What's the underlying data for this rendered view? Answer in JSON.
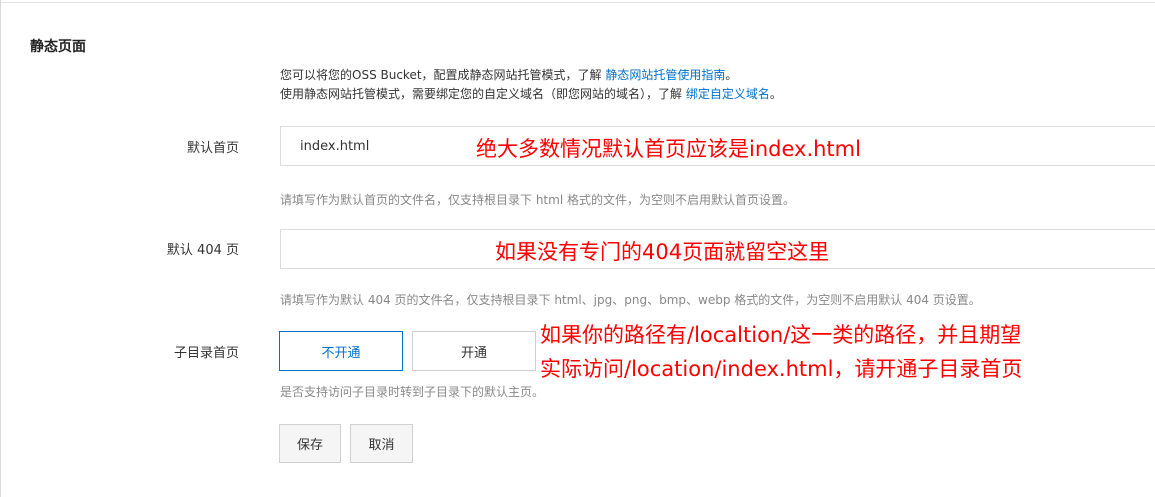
{
  "section": {
    "title": "静态页面"
  },
  "intro": {
    "line1_text": "您可以将您的OSS Bucket，配置成静态网站托管模式，了解 ",
    "line1_link": "静态网站托管使用指南",
    "line1_end": "。",
    "line2_text": "使用静态网站托管模式，需要绑定您的自定义域名（即您网站的域名），了解 ",
    "line2_link": "绑定自定义域名",
    "line2_end": "。"
  },
  "default_index": {
    "label": "默认首页",
    "value": "index.html",
    "help": "请填写作为默认首页的文件名，仅支持根目录下 html 格式的文件，为空则不启用默认首页设置。"
  },
  "default_404": {
    "label": "默认 404 页",
    "value": "",
    "help": "请填写作为默认 404 页的文件名，仅支持根目录下 html、jpg、png、bmp、webp 格式的文件，为空则不启用默认 404 页设置。"
  },
  "subdir_index": {
    "label": "子目录首页",
    "options": [
      "不开通",
      "开通"
    ],
    "selected": "不开通",
    "help": "是否支持访问子目录时转到子目录下的默认主页。"
  },
  "actions": {
    "save": "保存",
    "cancel": "取消"
  },
  "annotations": {
    "index_note": "绝大多数情况默认首页应该是index.html",
    "note_404": "如果没有专门的404页面就留空这里",
    "subdir_note_line1": "如果你的路径有/localtion/这一类的路径，并且期望",
    "subdir_note_line2": "实际访问/location/index.html，请开通子目录首页"
  },
  "colors": {
    "link": "#0070cc",
    "annotation": "#ff0000",
    "active_border": "#0070cc"
  }
}
